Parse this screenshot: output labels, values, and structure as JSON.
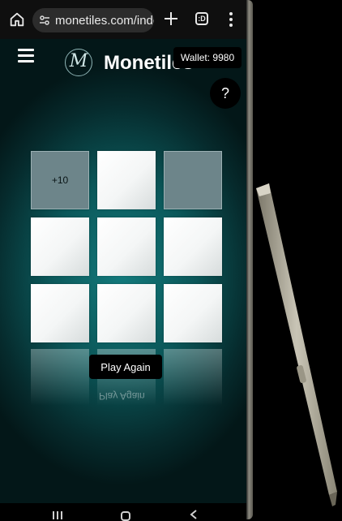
{
  "browser": {
    "url": "monetiles.com/index",
    "tab_count": ":D"
  },
  "app": {
    "name": "Monetiles",
    "logo_letter": "M",
    "wallet_label": "Wallet: 9980",
    "help_label": "?",
    "play_again_label": "Play Again"
  },
  "board": {
    "tiles": [
      {
        "state": "revealed",
        "text": "+10"
      },
      {
        "state": "hidden",
        "text": ""
      },
      {
        "state": "revealed",
        "text": ""
      },
      {
        "state": "hidden",
        "text": ""
      },
      {
        "state": "hidden",
        "text": ""
      },
      {
        "state": "hidden",
        "text": ""
      },
      {
        "state": "hidden",
        "text": ""
      },
      {
        "state": "hidden",
        "text": ""
      },
      {
        "state": "hidden",
        "text": ""
      }
    ]
  },
  "colors": {
    "accent_teal": "#0b5759",
    "revealed_tile": "#6d858a"
  }
}
